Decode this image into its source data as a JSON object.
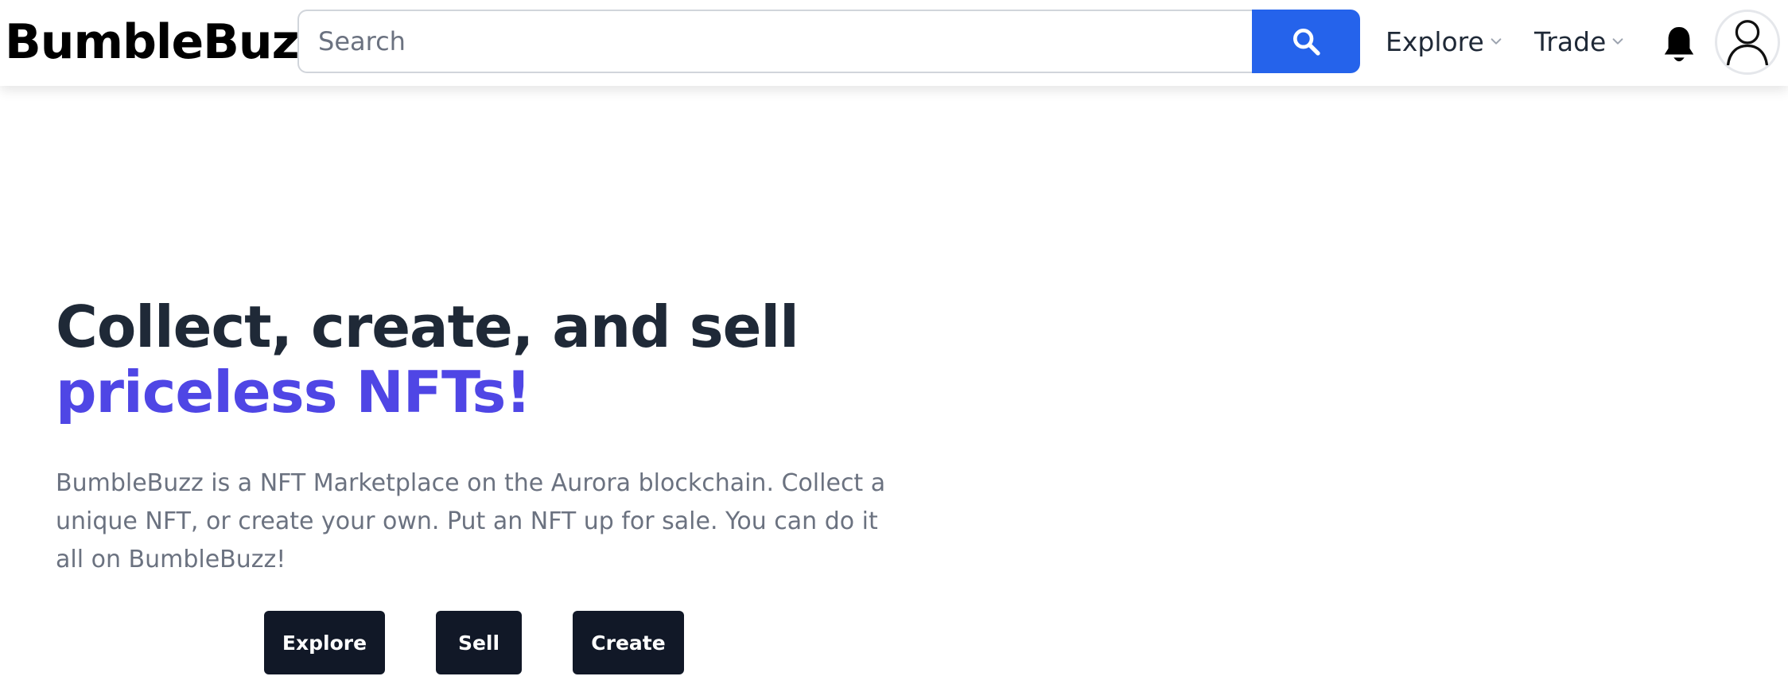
{
  "header": {
    "logo": "BumbleBuzz",
    "search": {
      "placeholder": "Search",
      "value": "",
      "icon": "search-icon"
    },
    "nav": [
      {
        "label": "Explore",
        "icon": "chevron-down-icon"
      },
      {
        "label": "Trade",
        "icon": "chevron-down-icon"
      }
    ],
    "notifications_icon": "bell-icon",
    "account_icon": "user-icon"
  },
  "hero": {
    "title_line1": "Collect, create, and sell",
    "title_line2": "priceless NFTs!",
    "description": "BumbleBuzz is a NFT Marketplace on the Aurora blockchain. Collect a unique NFT, or create your own. Put an NFT up for sale. You can do it all on BumbleBuzz!",
    "buttons": [
      {
        "label": "Explore"
      },
      {
        "label": "Sell"
      },
      {
        "label": "Create"
      }
    ]
  },
  "colors": {
    "accent": "#4f46e5",
    "search_button": "#2563eb",
    "button_dark": "#111827",
    "heading": "#1f2937",
    "body_text": "#6b7280"
  }
}
